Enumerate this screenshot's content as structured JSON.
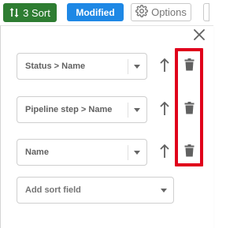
{
  "toolbar": {
    "sort_label": "3 Sort",
    "modified_label": "Modified",
    "options_label": "Options"
  },
  "sort_panel": {
    "rows": [
      {
        "field": "Status > Name"
      },
      {
        "field": "Pipeline step > Name"
      },
      {
        "field": "Name"
      }
    ],
    "add_placeholder": "Add sort field"
  },
  "icons": {
    "sort": "sort-arrows-icon",
    "options": "gear-icon",
    "close": "close-icon",
    "direction": "arrow-up-icon",
    "delete": "trash-icon",
    "dropdown": "chevron-down-icon"
  },
  "colors": {
    "sort_button": "#2e7d32",
    "modified_badge": "#1e88e5",
    "highlight": "#e0001b",
    "icon": "#616161"
  }
}
